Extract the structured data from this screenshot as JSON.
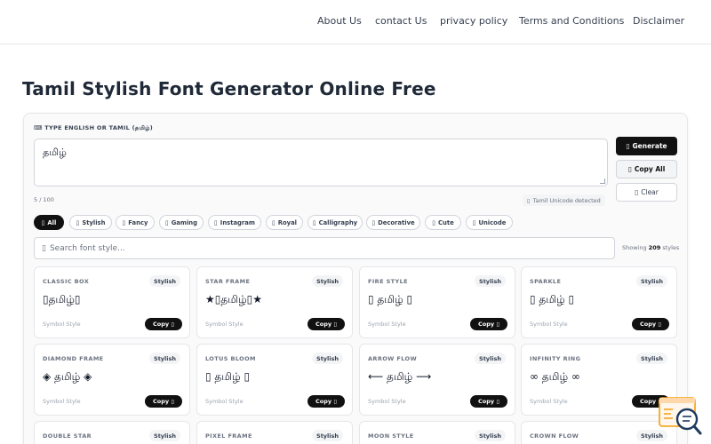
{
  "nav": {
    "items": [
      "About Us",
      "contact Us",
      "privacy policy",
      "Terms and Conditions",
      "Disclaimer"
    ]
  },
  "page": {
    "title": "Tamil Stylish Font Generator Online Free"
  },
  "editor": {
    "label": "⌨ TYPE ENGLISH OR TAMIL (தமிழ்)",
    "input_value": "தமிழ்",
    "char_count": "5 / 100",
    "detect_icon": "▯",
    "detect_text": "Tamil Unicode detected"
  },
  "actions": {
    "generate_icon": "▯",
    "generate_label": "Generate",
    "copyall_icon": "▯",
    "copyall_label": "Copy All",
    "clear_icon": "▯",
    "clear_label": "Clear"
  },
  "filters": [
    {
      "icon": "▯",
      "label": "All"
    },
    {
      "icon": "▯",
      "label": "Stylish"
    },
    {
      "icon": "▯",
      "label": "Fancy"
    },
    {
      "icon": "▯",
      "label": "Gaming"
    },
    {
      "icon": "▯",
      "label": "Instagram"
    },
    {
      "icon": "▯",
      "label": "Royal"
    },
    {
      "icon": "▯",
      "label": "Calligraphy"
    },
    {
      "icon": "▯",
      "label": "Decorative"
    },
    {
      "icon": "▯",
      "label": "Cute"
    },
    {
      "icon": "▯",
      "label": "Unicode"
    }
  ],
  "search": {
    "icon": "▯",
    "placeholder": "Search font style..."
  },
  "showing": {
    "prefix": "Showing",
    "count": "209",
    "suffix": "styles"
  },
  "fonts": [
    {
      "name": "CLASSIC BOX",
      "tag": "Stylish",
      "sample": "▯தமிழ்▯",
      "sub": "Symbol Style",
      "copy": "Copy ▯"
    },
    {
      "name": "STAR FRAME",
      "tag": "Stylish",
      "sample": "★▯தமிழ்▯★",
      "sub": "Symbol Style",
      "copy": "Copy ▯"
    },
    {
      "name": "FIRE STYLE",
      "tag": "Stylish",
      "sample": "▯ தமிழ் ▯",
      "sub": "Symbol Style",
      "copy": "Copy ▯"
    },
    {
      "name": "SPARKLE",
      "tag": "Stylish",
      "sample": "▯ தமிழ் ▯",
      "sub": "Symbol Style",
      "copy": "Copy ▯"
    },
    {
      "name": "DIAMOND FRAME",
      "tag": "Stylish",
      "sample": "◈ தமிழ் ◈",
      "sub": "Symbol Style",
      "copy": "Copy ▯"
    },
    {
      "name": "LOTUS BLOOM",
      "tag": "Stylish",
      "sample": "▯ தமிழ் ▯",
      "sub": "Symbol Style",
      "copy": "Copy ▯"
    },
    {
      "name": "ARROW FLOW",
      "tag": "Stylish",
      "sample": "⟵ தமிழ் ⟶",
      "sub": "Symbol Style",
      "copy": "Copy ▯"
    },
    {
      "name": "INFINITY RING",
      "tag": "Stylish",
      "sample": "∞ தமிழ் ∞",
      "sub": "Symbol Style",
      "copy": "Copy ▯"
    },
    {
      "name": "DOUBLE STAR",
      "tag": "Stylish",
      "sample": "",
      "sub": "",
      "copy": ""
    },
    {
      "name": "PIXEL FRAME",
      "tag": "Stylish",
      "sample": "",
      "sub": "",
      "copy": ""
    },
    {
      "name": "MOON STYLE",
      "tag": "Stylish",
      "sample": "",
      "sub": "",
      "copy": ""
    },
    {
      "name": "CROWN FLOW",
      "tag": "Stylish",
      "sample": "",
      "sub": "",
      "copy": ""
    }
  ]
}
